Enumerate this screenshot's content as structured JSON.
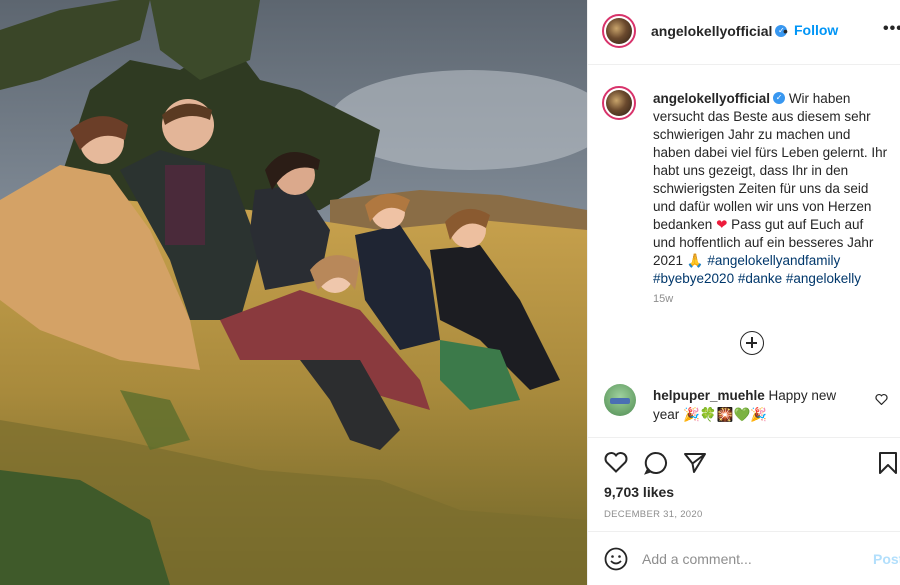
{
  "post": {
    "username": "angelokellyofficial",
    "verified": true,
    "follow_label": "Follow",
    "separator": "•",
    "more_label": "•••"
  },
  "caption": {
    "username": "angelokellyofficial",
    "text_1": "Wir haben versucht das Beste aus diesem sehr schwierigen Jahr zu machen und haben dabei viel fürs Leben gelernt. Ihr habt uns gezeigt, dass Ihr in den schwierigsten Zeiten für uns da seid und dafür wollen wir uns von Herzen bedanken",
    "heart": "❤",
    "text_2": "Pass gut auf Euch auf und hoffentlich auf ein besseres Jahr 2021",
    "pray": "🙏",
    "tag_1": "#angelokellyandfamily",
    "tag_2": "#byebye2020",
    "tag_3": "#danke",
    "tag_4": "#angelokelly",
    "time_ago": "15w"
  },
  "comments": [
    {
      "username": "helpuper_muehle",
      "text": "Happy new year",
      "emojis": "🎉🍀🎇💚🎉"
    }
  ],
  "stats": {
    "likes": "9,703 likes",
    "date": "DECEMBER 31, 2020"
  },
  "comment_input": {
    "placeholder": "Add a comment...",
    "post_label": "Post"
  },
  "icons": {
    "like": "heart-icon",
    "comment": "comment-icon",
    "share": "send-icon",
    "save": "bookmark-icon",
    "emoji": "emoji-icon",
    "load_more": "plus-circle-icon",
    "verified": "verified-badge-icon"
  },
  "colors": {
    "follow": "#0095f6",
    "hashtag": "#00376b",
    "verified": "#3897f0",
    "post_disabled": "#b2dffc",
    "muted": "#8e8e8e"
  }
}
